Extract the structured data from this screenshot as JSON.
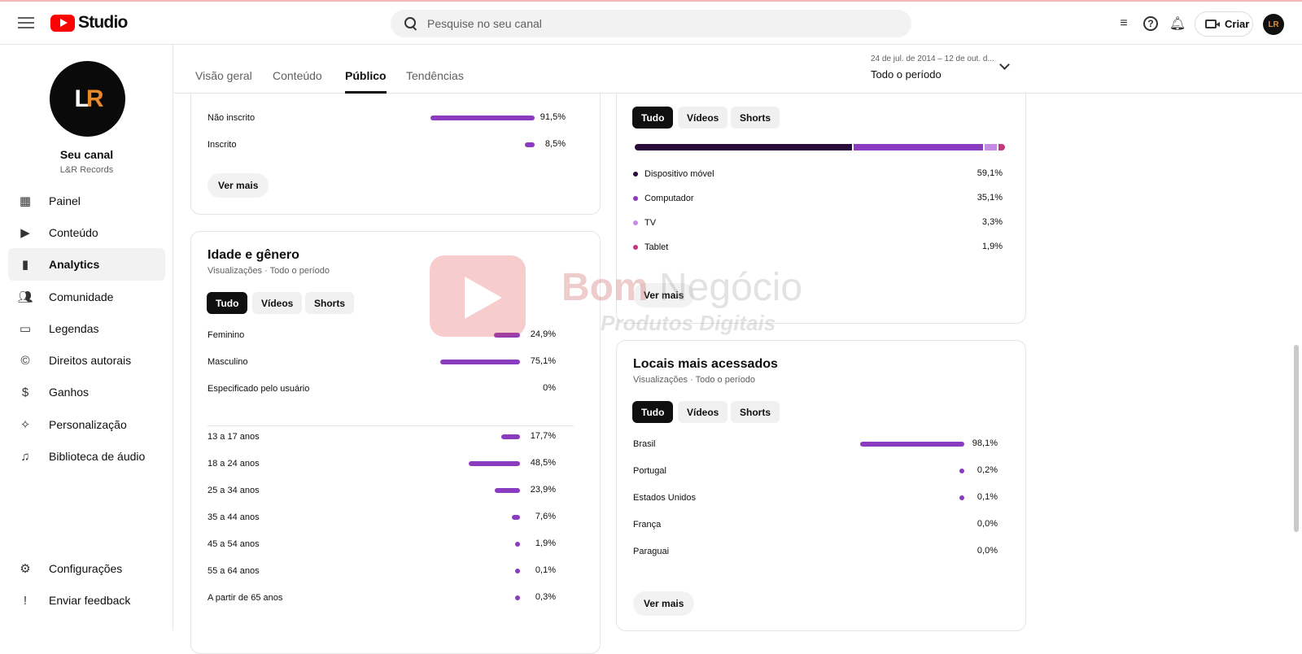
{
  "header": {
    "logo_text": "Studio",
    "search_placeholder": "Pesquise no seu canal",
    "create_label": "Criar",
    "avatar_initials": "LR"
  },
  "sidebar": {
    "channel_avatar_text": "LR",
    "channel_title": "Seu canal",
    "channel_name": "L&R Records",
    "items": [
      {
        "label": "Painel",
        "icon": "dashboard-icon"
      },
      {
        "label": "Conteúdo",
        "icon": "content-icon"
      },
      {
        "label": "Analytics",
        "icon": "analytics-icon",
        "active": true
      },
      {
        "label": "Comunidade",
        "icon": "community-icon"
      },
      {
        "label": "Legendas",
        "icon": "subtitles-icon"
      },
      {
        "label": "Direitos autorais",
        "icon": "copyright-icon"
      },
      {
        "label": "Ganhos",
        "icon": "earn-icon"
      },
      {
        "label": "Personalização",
        "icon": "magic-wand-icon"
      },
      {
        "label": "Biblioteca de áudio",
        "icon": "audio-library-icon"
      }
    ],
    "bottom_items": [
      {
        "label": "Configurações",
        "icon": "settings-icon"
      },
      {
        "label": "Enviar feedback",
        "icon": "feedback-icon"
      }
    ]
  },
  "tabs": [
    "Visão geral",
    "Conteúdo",
    "Público",
    "Tendências"
  ],
  "active_tab": "Público",
  "date_range": {
    "range": "24 de jul. de 2014 – 12 de out. d...",
    "label": "Todo o período"
  },
  "subscription_card": {
    "rows": [
      {
        "label": "Não inscrito",
        "value": "91,5%",
        "fraction": 0.915
      },
      {
        "label": "Inscrito",
        "value": "8,5%",
        "fraction": 0.085
      }
    ],
    "more_label": "Ver mais"
  },
  "age_gender_card": {
    "title": "Idade e gênero",
    "subtitle": "Visualizações · Todo o período",
    "chips": [
      "Tudo",
      "Vídeos",
      "Shorts"
    ],
    "gender_rows": [
      {
        "label": "Feminino",
        "value": "24,9%",
        "fraction": 0.249
      },
      {
        "label": "Masculino",
        "value": "75,1%",
        "fraction": 0.751
      },
      {
        "label": "Especificado pelo usuário",
        "value": "0%",
        "fraction": 0
      }
    ],
    "age_rows": [
      {
        "label": "13 a 17 anos",
        "value": "17,7%",
        "fraction": 0.177
      },
      {
        "label": "18 a 24 anos",
        "value": "48,5%",
        "fraction": 0.485
      },
      {
        "label": "25 a 34 anos",
        "value": "23,9%",
        "fraction": 0.239
      },
      {
        "label": "35 a 44 anos",
        "value": "7,6%",
        "fraction": 0.076
      },
      {
        "label": "45 a 54 anos",
        "value": "1,9%",
        "fraction": 0.019
      },
      {
        "label": "55 a 64 anos",
        "value": "0,1%",
        "fraction": 0.001
      },
      {
        "label": "A partir de 65 anos",
        "value": "0,3%",
        "fraction": 0.003
      }
    ]
  },
  "device_card": {
    "chips": [
      "Tudo",
      "Vídeos",
      "Shorts"
    ],
    "rows": [
      {
        "label": "Dispositivo móvel",
        "value": "59,1%",
        "fraction": 0.591,
        "color": "#2a0a3a"
      },
      {
        "label": "Computador",
        "value": "35,1%",
        "fraction": 0.351,
        "color": "#8b3bbf"
      },
      {
        "label": "TV",
        "value": "3,3%",
        "fraction": 0.033,
        "color": "#c78be6"
      },
      {
        "label": "Tablet",
        "value": "1,9%",
        "fraction": 0.019,
        "color": "#c2387a"
      }
    ],
    "more_label": "Ver mais"
  },
  "locations_card": {
    "title": "Locais mais acessados",
    "subtitle": "Visualizações · Todo o período",
    "chips": [
      "Tudo",
      "Vídeos",
      "Shorts"
    ],
    "rows": [
      {
        "label": "Brasil",
        "value": "98,1%",
        "fraction": 0.981
      },
      {
        "label": "Portugal",
        "value": "0,2%",
        "fraction": 0.002
      },
      {
        "label": "Estados Unidos",
        "value": "0,1%",
        "fraction": 0.001
      },
      {
        "label": "França",
        "value": "0,0%",
        "fraction": 0
      },
      {
        "label": "Paraguai",
        "value": "0,0%",
        "fraction": 0
      }
    ],
    "more_label": "Ver mais"
  },
  "watermark": {
    "line1a": "Bom",
    "line1b": "Negócio",
    "line2": "Produtos Digitais"
  },
  "colors": {
    "bar": "#8b3bbf",
    "brand_red": "#ff0000"
  }
}
